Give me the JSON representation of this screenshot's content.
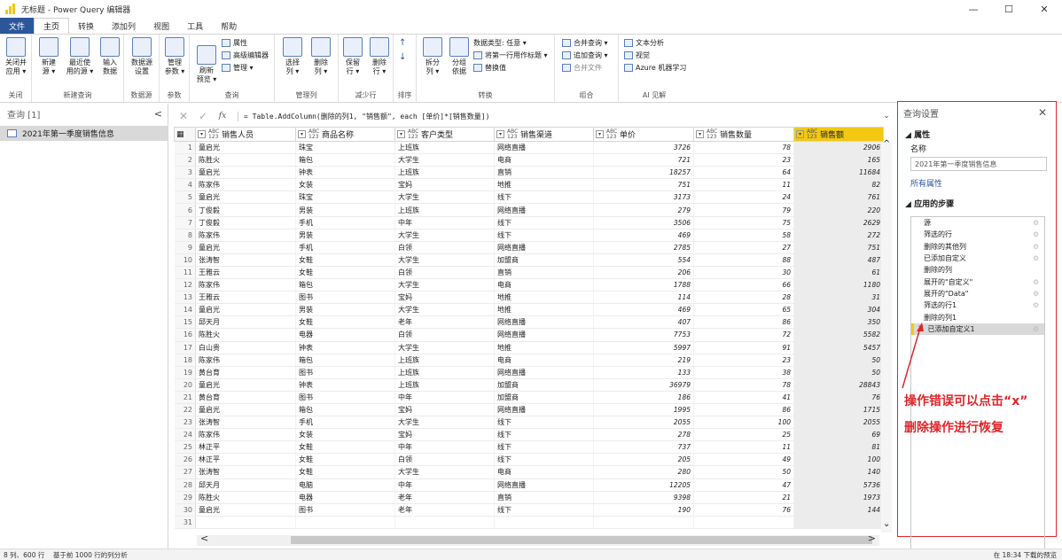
{
  "window": {
    "title": "无标题 - Power Query 编辑器",
    "minimize": "—",
    "maximize": "☐",
    "close": "✕"
  },
  "tabs": [
    "文件",
    "主页",
    "转换",
    "添加列",
    "视图",
    "工具",
    "帮助"
  ],
  "ribbon": {
    "close_apply": "关闭并\n应用 ▾",
    "new_source": "新建\n源 ▾",
    "recent_source": "最近使\n用的源 ▾",
    "enter_data": "输入\n数据",
    "source_settings": "数据源\n设置",
    "manage_params": "管理\n参数 ▾",
    "refresh_preview": "刷新\n预览 ▾",
    "properties": "属性",
    "advanced_editor": "高级编辑器",
    "manage": "管理 ▾",
    "choose_cols": "选择\n列 ▾",
    "remove_cols": "删除\n列 ▾",
    "keep_rows": "保留\n行 ▾",
    "remove_rows": "删除\n行 ▾",
    "split_col": "拆分\n列 ▾",
    "group_by": "分组\n依据",
    "data_type": "数据类型: 任意 ▾",
    "first_row_header": "将第一行用作标题 ▾",
    "replace_values": "替换值",
    "merge_queries": "合并查询 ▾",
    "append_queries": "追加查询 ▾",
    "combine_files": "合并文件",
    "text_analytics": "文本分析",
    "vision": "视觉",
    "azure_ml": "Azure 机器学习",
    "groups": [
      "关闭",
      "新建查询",
      "数据源",
      "参数",
      "查询",
      "管理列",
      "减少行",
      "排序",
      "转换",
      "组合",
      "AI 见解"
    ]
  },
  "left_pane": {
    "header": "查询 [1]",
    "collapse": "<",
    "query": "2021年第一季度销售信息"
  },
  "formula": {
    "text": "= Table.AddColumn(删除的列1, \"销售额\", each [单价]*[销售数量])",
    "cancel": "✕",
    "confirm": "✓",
    "fx": "fx",
    "expand": "⌄"
  },
  "columns": [
    {
      "type": "ABC\n123",
      "name": "销售人员"
    },
    {
      "type": "ABC\n123",
      "name": "商品名称"
    },
    {
      "type": "ABC\n123",
      "name": "客户类型"
    },
    {
      "type": "ABC\n123",
      "name": "销售渠道"
    },
    {
      "type": "ABC\n123",
      "name": "单价"
    },
    {
      "type": "ABC\n123",
      "name": "销售数量"
    },
    {
      "type": "ABC\n123",
      "name": "销售额"
    }
  ],
  "rows": [
    [
      "1",
      "童启光",
      "珠宝",
      "上班族",
      "网络直播",
      "3726",
      "78",
      "2906"
    ],
    [
      "2",
      "陈胜火",
      "箱包",
      "大学生",
      "电商",
      "721",
      "23",
      "165"
    ],
    [
      "3",
      "童启光",
      "钟表",
      "上班族",
      "直销",
      "18257",
      "64",
      "11684"
    ],
    [
      "4",
      "陈家伟",
      "女装",
      "宝妈",
      "地推",
      "751",
      "11",
      "82"
    ],
    [
      "5",
      "童启光",
      "珠宝",
      "大学生",
      "线下",
      "3173",
      "24",
      "761"
    ],
    [
      "6",
      "丁俊毅",
      "男装",
      "上班族",
      "网络直播",
      "279",
      "79",
      "220"
    ],
    [
      "7",
      "丁俊毅",
      "手机",
      "中年",
      "线下",
      "3506",
      "75",
      "2629"
    ],
    [
      "8",
      "陈家伟",
      "男装",
      "大学生",
      "线下",
      "469",
      "58",
      "272"
    ],
    [
      "9",
      "童启光",
      "手机",
      "白领",
      "网络直播",
      "2785",
      "27",
      "751"
    ],
    [
      "10",
      "张涛智",
      "女鞋",
      "大学生",
      "加盟商",
      "554",
      "88",
      "487"
    ],
    [
      "11",
      "王雅云",
      "女鞋",
      "白领",
      "直销",
      "206",
      "30",
      "61"
    ],
    [
      "12",
      "陈家伟",
      "箱包",
      "大学生",
      "电商",
      "1788",
      "66",
      "1180"
    ],
    [
      "13",
      "王雅云",
      "图书",
      "宝妈",
      "地推",
      "114",
      "28",
      "31"
    ],
    [
      "14",
      "童启光",
      "男装",
      "大学生",
      "地推",
      "469",
      "65",
      "304"
    ],
    [
      "15",
      "邱天月",
      "女鞋",
      "老年",
      "网络直播",
      "407",
      "86",
      "350"
    ],
    [
      "16",
      "陈胜火",
      "电器",
      "白领",
      "网络直播",
      "7753",
      "72",
      "5582"
    ],
    [
      "17",
      "白山贵",
      "钟表",
      "大学生",
      "地推",
      "5997",
      "91",
      "5457"
    ],
    [
      "18",
      "陈家伟",
      "箱包",
      "上班族",
      "电商",
      "219",
      "23",
      "50"
    ],
    [
      "19",
      "黄台育",
      "图书",
      "上班族",
      "网络直播",
      "133",
      "38",
      "50"
    ],
    [
      "20",
      "童启光",
      "钟表",
      "上班族",
      "加盟商",
      "36979",
      "78",
      "28843"
    ],
    [
      "21",
      "黄台育",
      "图书",
      "中年",
      "加盟商",
      "186",
      "41",
      "76"
    ],
    [
      "22",
      "童启光",
      "箱包",
      "宝妈",
      "网络直播",
      "1995",
      "86",
      "1715"
    ],
    [
      "23",
      "张涛智",
      "手机",
      "大学生",
      "线下",
      "2055",
      "100",
      "2055"
    ],
    [
      "24",
      "陈家伟",
      "女装",
      "宝妈",
      "线下",
      "278",
      "25",
      "69"
    ],
    [
      "25",
      "林正平",
      "女鞋",
      "中年",
      "线下",
      "737",
      "11",
      "81"
    ],
    [
      "26",
      "林正平",
      "女鞋",
      "白领",
      "线下",
      "205",
      "49",
      "100"
    ],
    [
      "27",
      "张涛智",
      "女鞋",
      "大学生",
      "电商",
      "280",
      "50",
      "140"
    ],
    [
      "28",
      "邱天月",
      "电脑",
      "中年",
      "网络直播",
      "12205",
      "47",
      "5736"
    ],
    [
      "29",
      "陈胜火",
      "电器",
      "老年",
      "直销",
      "9398",
      "21",
      "1973"
    ],
    [
      "30",
      "童启光",
      "图书",
      "老年",
      "线下",
      "190",
      "76",
      "144"
    ],
    [
      "31",
      "",
      "",
      "",
      "",
      "",
      "",
      ""
    ]
  ],
  "right_pane": {
    "header": "查询设置",
    "close": "✕",
    "properties": "属性",
    "name_label": "名称",
    "name_value": "2021年第一季度销售信息",
    "all_props": "所有属性",
    "applied_steps": "应用的步骤",
    "steps": [
      "源",
      "筛选的行",
      "删除的其他列",
      "已添加自定义",
      "删除的列",
      "展开的\"自定义\"",
      "展开的\"Data\"",
      "筛选的行1",
      "删除的列1",
      "已添加自定义1"
    ]
  },
  "annotation": {
    "line1": "操作错误可以点击“x”",
    "line2": "删除操作进行恢复"
  },
  "status": {
    "left": "8 列、600 行    基于前 1000 行的列分析",
    "right": "在 18:34 下载的预览"
  },
  "colors": {
    "accent": "#f2c811",
    "annotation": "#e0262b",
    "file_tab": "#2b579a"
  }
}
